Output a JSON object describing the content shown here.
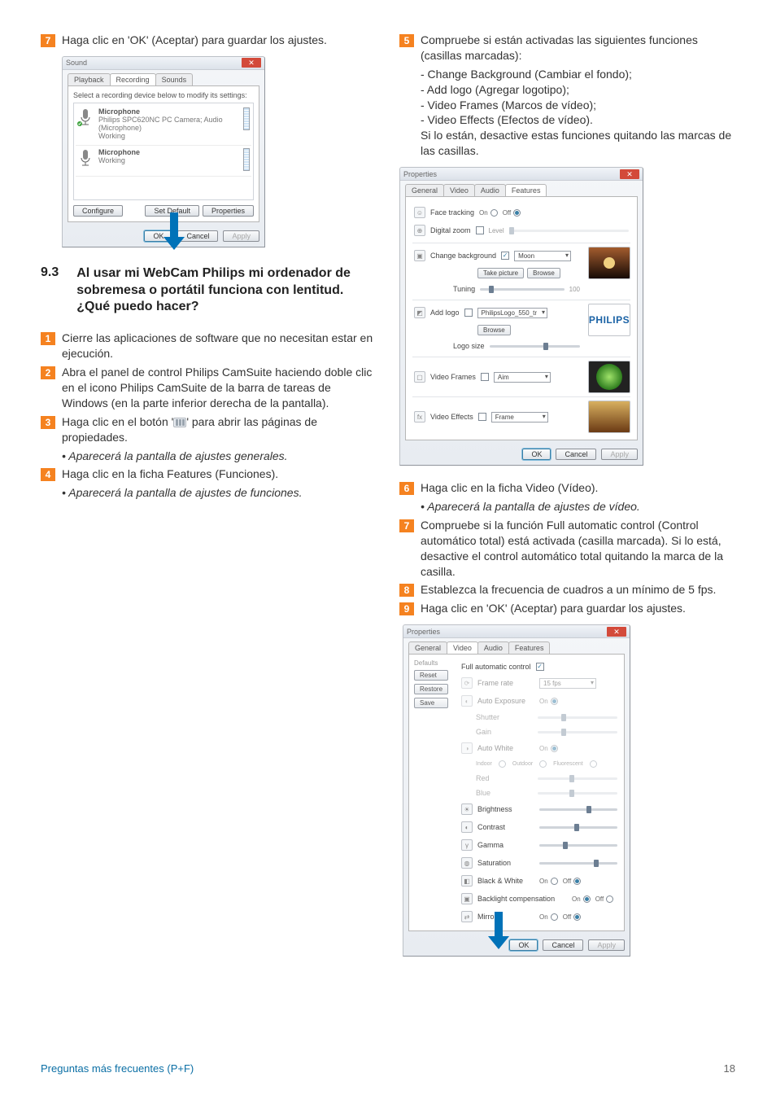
{
  "col1": {
    "step7": "Haga clic en 'OK' (Aceptar) para guardar los ajustes.",
    "sound_window": {
      "title": "Sound",
      "tabs": {
        "playback": "Playback",
        "recording": "Recording",
        "sounds": "Sounds"
      },
      "instruction": "Select a recording device below to modify its settings:",
      "device1": {
        "name": "Microphone",
        "desc": "Philips SPC620NC PC Camera; Audio (Microphone)",
        "status": "Working"
      },
      "device2": {
        "name": "Microphone",
        "desc": "",
        "status": "Working"
      },
      "configure": "Configure",
      "set_default": "Set Default",
      "properties": "Properties",
      "ok": "OK",
      "cancel": "Cancel",
      "apply": "Apply"
    },
    "heading_num": "9.3",
    "heading_txt": "Al usar mi WebCam Philips mi ordenador de sobremesa o portátil funciona con lentitud. ¿Qué puedo hacer?",
    "step1": "Cierre las aplicaciones de software que no necesitan estar en ejecución.",
    "step2": "Abra el panel de control Philips CamSuite haciendo doble clic en el icono Philips CamSuite de la barra de tareas de Windows (en la parte inferior derecha de la pantalla).",
    "step3_a": "Haga clic en el botón '",
    "step3_b": "' para abrir las páginas de propiedades.",
    "step3_bullet": "• Aparecerá la pantalla de ajustes generales.",
    "step4": "Haga clic en la ficha Features (Funciones).",
    "step4_bullet": "• Aparecerá la pantalla de ajustes de funciones."
  },
  "col2": {
    "step5": "Compruebe si están activadas las siguientes funciones (casillas marcadas):",
    "step5_lines": [
      "- Change Background (Cambiar el fondo);",
      "- Add logo (Agregar logotipo);",
      "- Video Frames (Marcos de vídeo);",
      "- Video Effects (Efectos de vídeo).",
      "Si lo están, desactive estas funciones quitando las marcas de las casillas."
    ],
    "features_window": {
      "title": "Properties",
      "tabs": {
        "general": "General",
        "video": "Video",
        "audio": "Audio",
        "features": "Features"
      },
      "face_tracking": "Face tracking",
      "on": "On",
      "off": "Off",
      "digital_zoom": "Digital zoom",
      "level": "Level",
      "change_bg": "Change background",
      "moon": "Moon",
      "take_picture": "Take picture",
      "browse": "Browse",
      "tuning": "Tuning",
      "tuning_max": "100",
      "add_logo": "Add logo",
      "logo_file": "PhilipsLogo_550_tr",
      "logo_size": "Logo size",
      "philips": "PHILIPS",
      "video_frames": "Video Frames",
      "aim": "Aim",
      "video_effects": "Video Effects",
      "frame": "Frame",
      "ok": "OK",
      "cancel": "Cancel",
      "apply": "Apply"
    },
    "step6": "Haga clic en la ficha Video (Vídeo).",
    "step6_bullet": "• Aparecerá la pantalla de ajustes de vídeo.",
    "step7": "Compruebe si la función Full automatic control (Control automático total) está activada (casilla marcada). Si lo está, desactive el control automático total quitando la marca de la casilla.",
    "step8": "Establezca la frecuencia de cuadros a un mínimo de 5 fps.",
    "step9": "Haga clic en 'OK' (Aceptar) para guardar los ajustes.",
    "video_window": {
      "title": "Properties",
      "tabs": {
        "general": "General",
        "video": "Video",
        "audio": "Audio",
        "features": "Features"
      },
      "full_auto": "Full automatic control",
      "defaults": "Defaults",
      "reset": "Reset",
      "restore": "Restore",
      "save": "Save",
      "frame_rate": "Frame rate",
      "fps": "15 fps",
      "auto_exp": "Auto Exposure",
      "shutter": "Shutter",
      "gain": "Gain",
      "auto_wb": "Auto White",
      "indoor": "Indoor",
      "outdoor": "Outdoor",
      "fluor": "Fluorescent",
      "red": "Red",
      "blue": "Blue",
      "brightness": "Brightness",
      "contrast": "Contrast",
      "gamma": "Gamma",
      "saturation": "Saturation",
      "bw": "Black & White",
      "backlight": "Backlight compensation",
      "mirror": "Mirror",
      "on": "On",
      "off": "Off",
      "ok": "OK",
      "cancel": "Cancel",
      "apply": "Apply"
    }
  },
  "footer": {
    "left": "Preguntas más frecuentes (P+F)",
    "right": "18"
  }
}
